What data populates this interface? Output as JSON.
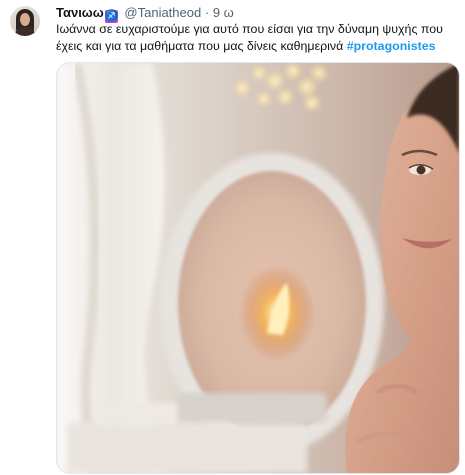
{
  "tweet": {
    "author_name": "Τανιωω",
    "badge_symbol": "♐",
    "handle": "@Taniatheod",
    "separator": "·",
    "time": "9 ω",
    "text": "Ιωάννα σε ευχαριστούμε για αυτό που είσαι για την δύναμη ψυχής που έχεις και για τα μαθήματα που μας δίνεις καθημερινά ",
    "hashtag": "#protagonistes",
    "hashtag_color": "#1d9bf0",
    "badge_color": "#9c4fd6"
  }
}
